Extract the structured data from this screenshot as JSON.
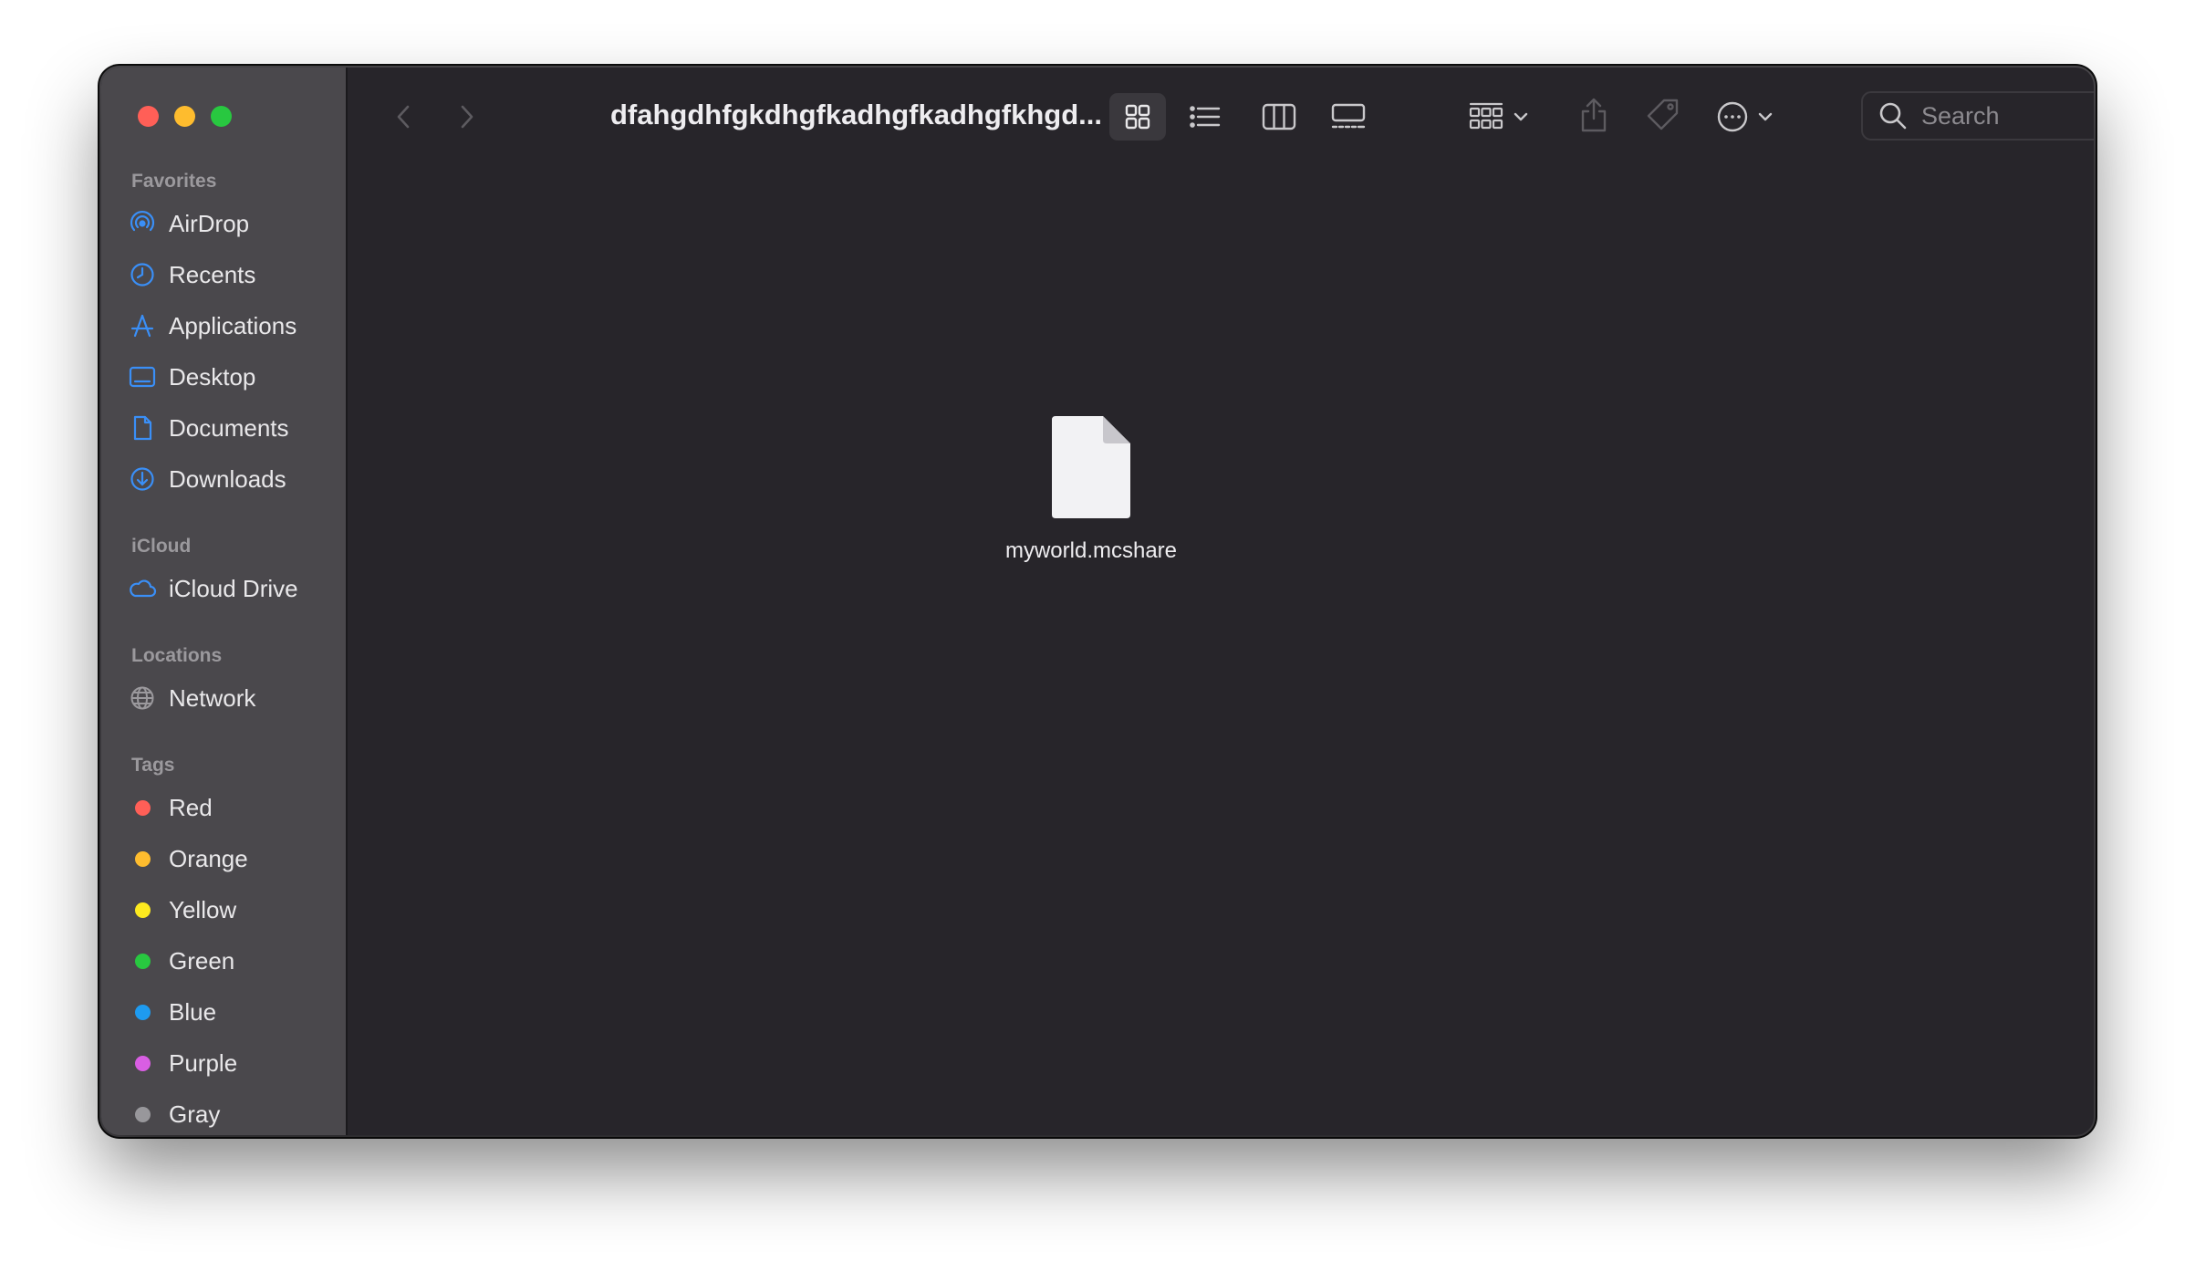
{
  "window": {
    "title": "dfahgdhfgkdhgfkadhgfkadhgfkhgd..."
  },
  "sidebar": {
    "favorites_header": "Favorites",
    "favorites": [
      {
        "label": "AirDrop",
        "icon": "airdrop-icon"
      },
      {
        "label": "Recents",
        "icon": "clock-icon"
      },
      {
        "label": "Applications",
        "icon": "applications-icon"
      },
      {
        "label": "Desktop",
        "icon": "desktop-icon"
      },
      {
        "label": "Documents",
        "icon": "document-icon"
      },
      {
        "label": "Downloads",
        "icon": "download-icon"
      }
    ],
    "icloud_header": "iCloud",
    "icloud": [
      {
        "label": "iCloud Drive",
        "icon": "cloud-icon"
      }
    ],
    "locations_header": "Locations",
    "locations": [
      {
        "label": "Network",
        "icon": "globe-icon"
      }
    ],
    "tags_header": "Tags",
    "tags": [
      {
        "label": "Red",
        "color": "#ff5f57"
      },
      {
        "label": "Orange",
        "color": "#febc2e"
      },
      {
        "label": "Yellow",
        "color": "#fdea1f"
      },
      {
        "label": "Green",
        "color": "#28c840"
      },
      {
        "label": "Blue",
        "color": "#1e9bf0"
      },
      {
        "label": "Purple",
        "color": "#d95ee3"
      },
      {
        "label": "Gray",
        "color": "#98979b"
      }
    ],
    "accent_color": "#3a8ff7"
  },
  "toolbar": {
    "search_placeholder": "Search",
    "selected_view": "icon-view"
  },
  "content": {
    "files": [
      {
        "name": "myworld.mcshare",
        "icon": "generic-file-icon"
      }
    ]
  }
}
